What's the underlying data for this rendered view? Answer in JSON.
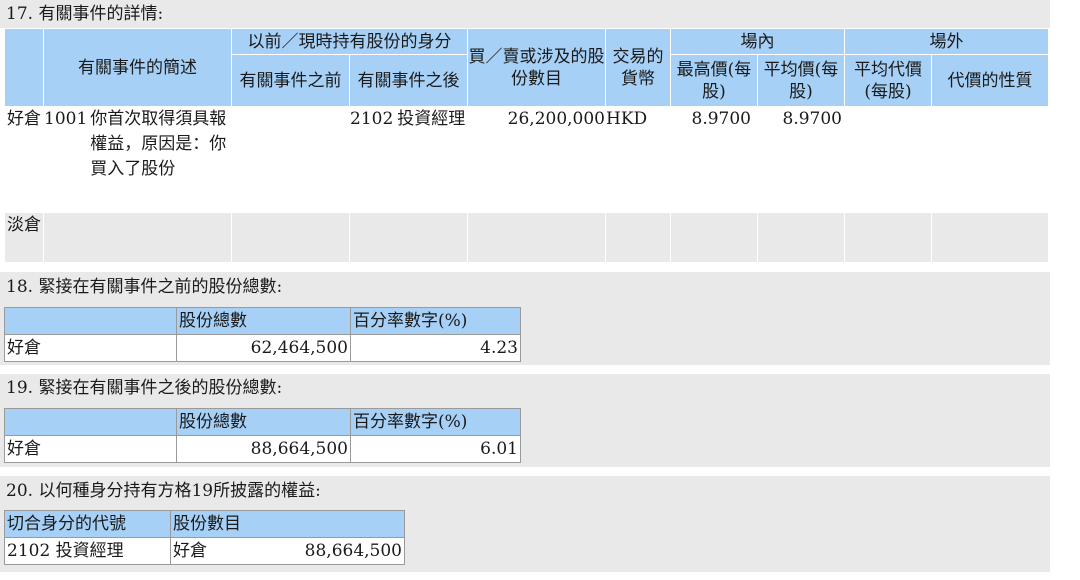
{
  "s17": {
    "title": "17. 有關事件的詳情:",
    "headers": {
      "desc": "有關事件的簡述",
      "capacity_group": "以前／現時持有股份的身分",
      "before": "有關事件之前",
      "after": "有關事件之後",
      "shares": "買／賣或涉及的股份數目",
      "currency": "交易的貨幣",
      "onex": "場內",
      "offex": "場外",
      "highest": "最高價(每股)",
      "average": "平均價(每股)",
      "avg_consid": "平均代價(每股)",
      "consid_nature": "代價的性質"
    },
    "long_row": {
      "label": "好倉",
      "code": "1001",
      "desc": "你首次取得須具報權益，原因是：你買入了股份",
      "before": "",
      "after_code": "2102",
      "after": "投資經理",
      "shares": "26,200,000",
      "currency": "HKD",
      "highest": "8.9700",
      "average": "8.9700"
    },
    "short_row": {
      "label": "淡倉"
    }
  },
  "s18": {
    "title": "18. 緊接在有關事件之前的股份總數:",
    "col1": "股份總數",
    "col2": "百分率數字(%)",
    "row_label": "好倉",
    "total": "62,464,500",
    "pct": "4.23"
  },
  "s19": {
    "title": "19. 緊接在有關事件之後的股份總數:",
    "col1": "股份總數",
    "col2": "百分率數字(%)",
    "row_label": "好倉",
    "total": "88,664,500",
    "pct": "6.01"
  },
  "s20": {
    "title": "20. 以何種身分持有方格19所披露的權益:",
    "col1": "切合身分的代號",
    "col2": "股份數目",
    "code": "2102",
    "capacity": "投資經理",
    "position": "好倉",
    "shares": "88,664,500"
  }
}
